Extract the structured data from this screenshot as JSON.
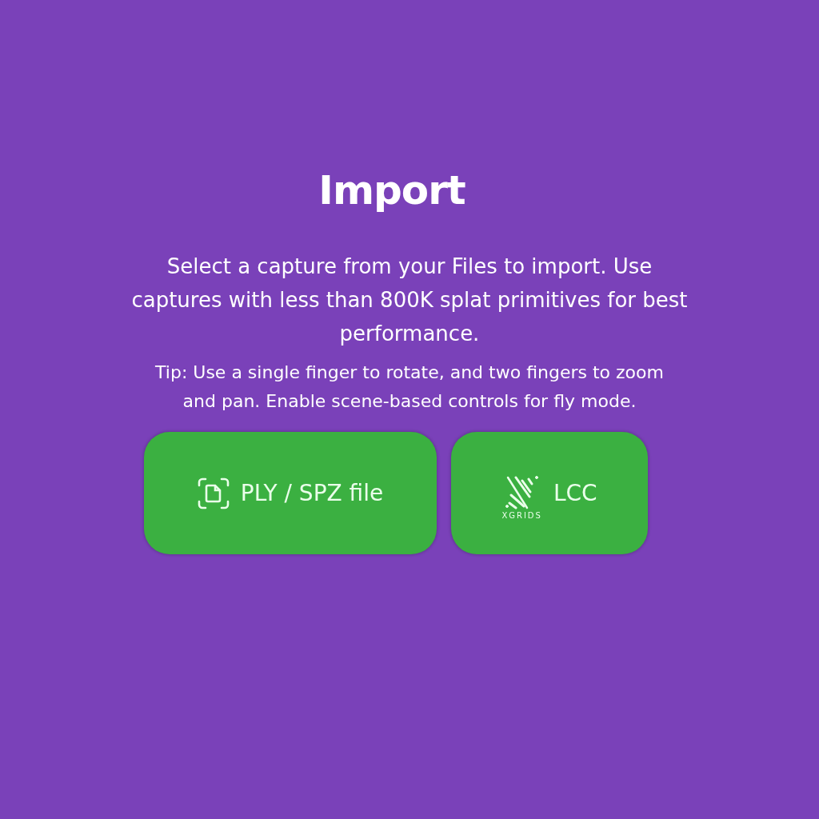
{
  "title": "Import",
  "description": "Select a capture from your Files to import. Use captures with less than 800K splat primitives for best performance.",
  "tip": "Tip: Use a single finger to rotate, and two fingers to zoom and pan. Enable scene-based controls for fly mode.",
  "buttons": [
    {
      "kind": "file",
      "label": "PLY / SPZ file"
    },
    {
      "kind": "xgrids",
      "label": "LCC",
      "logo_text": "XGRIDS"
    }
  ]
}
